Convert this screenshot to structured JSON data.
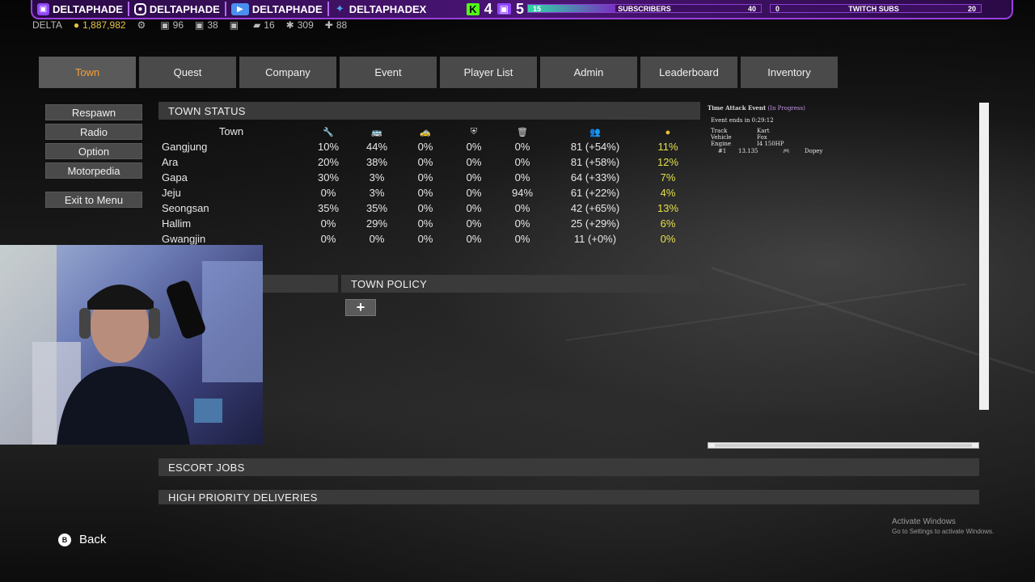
{
  "overlay": {
    "socials": [
      {
        "icon": "twitch-icon",
        "handle": "DELTAPHADE"
      },
      {
        "icon": "instagram-icon",
        "handle": "DELTAPHADE"
      },
      {
        "icon": "youtube-icon",
        "handle": "DELTAPHADE"
      },
      {
        "icon": "twitter-icon",
        "handle": "DELTAPHADEX"
      }
    ],
    "kick_count": "4",
    "twitch_count": "5",
    "subscribers": {
      "current": "15",
      "label": "SUBSCRIBERS",
      "goal": "40",
      "progress": 0.375
    },
    "twitch_subs": {
      "current": "0",
      "label": "TWITCH SUBS",
      "goal": "20",
      "progress": 0.0
    }
  },
  "player_stats": {
    "name": "DELTA",
    "money": "1,887,982",
    "items": [
      "",
      "96",
      "38",
      "",
      "16",
      "309",
      "88"
    ]
  },
  "tabs": [
    {
      "label": "Town",
      "active": true
    },
    {
      "label": "Quest"
    },
    {
      "label": "Company"
    },
    {
      "label": "Event"
    },
    {
      "label": "Player List"
    },
    {
      "label": "Admin"
    },
    {
      "label": "Leaderboard"
    },
    {
      "label": "Inventory"
    }
  ],
  "side_menu": [
    "Respawn",
    "Radio",
    "Option",
    "Motorpedia",
    "Exit to Menu"
  ],
  "town_status": {
    "title": "TOWN STATUS",
    "col_town": "Town",
    "rows": [
      {
        "town": "Gangjung",
        "v": [
          "10%",
          "44%",
          "0%",
          "0%",
          "0%"
        ],
        "pop": "81 (+54%)",
        "gold": "11%"
      },
      {
        "town": "Ara",
        "v": [
          "20%",
          "38%",
          "0%",
          "0%",
          "0%"
        ],
        "pop": "81 (+58%)",
        "gold": "12%"
      },
      {
        "town": "Gapa",
        "v": [
          "30%",
          "3%",
          "0%",
          "0%",
          "0%"
        ],
        "pop": "64 (+33%)",
        "gold": "7%"
      },
      {
        "town": "Jeju",
        "v": [
          "0%",
          "3%",
          "0%",
          "0%",
          "94%"
        ],
        "pop": "61 (+22%)",
        "gold": "4%"
      },
      {
        "town": "Seongsan",
        "v": [
          "35%",
          "35%",
          "0%",
          "0%",
          "0%"
        ],
        "pop": "42 (+65%)",
        "gold": "13%"
      },
      {
        "town": "Hallim",
        "v": [
          "0%",
          "29%",
          "0%",
          "0%",
          "0%"
        ],
        "pop": "25 (+29%)",
        "gold": "6%"
      },
      {
        "town": "Gwangjin",
        "v": [
          "0%",
          "0%",
          "0%",
          "0%",
          "0%"
        ],
        "pop": "11 (+0%)",
        "gold": "0%"
      }
    ]
  },
  "town_policy": {
    "title": "TOWN POLICY",
    "add": "+"
  },
  "event": {
    "title": "Time Attack Event",
    "status": "(In Progress)",
    "ends": "Event ends in 0:29:12",
    "track_k": "Track",
    "track_v": "Kart",
    "vehicle_k": "Vehicle",
    "vehicle_v": "Fox",
    "engine_k": "Engine",
    "engine_v": "I4 150HP",
    "rank": "#1",
    "time": "13.135",
    "player": "Dopey"
  },
  "sections": {
    "escort": "ESCORT JOBS",
    "hpd": "HIGH PRIORITY DELIVERIES"
  },
  "back": {
    "key": "B",
    "label": "Back"
  },
  "watermark": {
    "line1": "Activate Windows",
    "line2": "Go to Settings to activate Windows."
  }
}
